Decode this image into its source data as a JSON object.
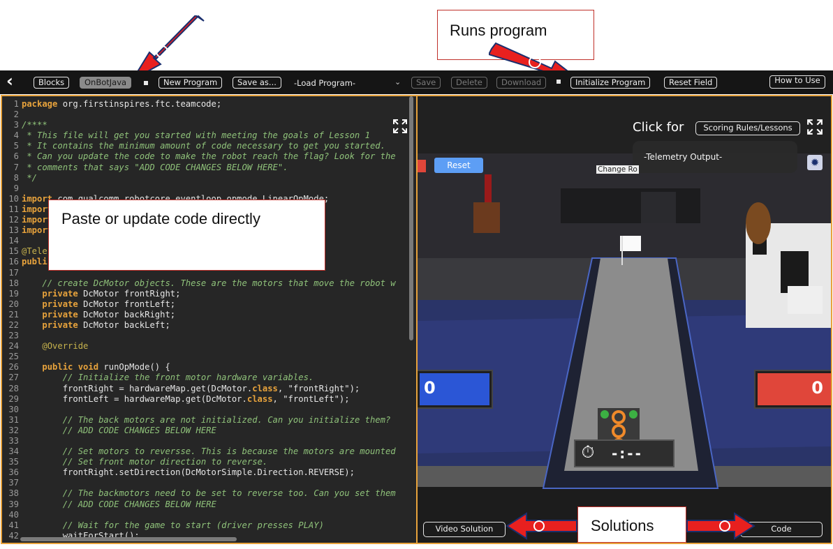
{
  "toolbar": {
    "back_glyph": "‹",
    "blocks": "Blocks",
    "onbotjava": "OnBotJava",
    "new_program": "New Program",
    "save_as": "Save as...",
    "load_program": "-Load Program-",
    "save": "Save",
    "delete": "Delete",
    "download": "Download",
    "initialize": "Initialize Program",
    "reset_field": "Reset Field",
    "how_to_use": "How to Use"
  },
  "callouts": {
    "runs_program": "Runs program",
    "paste_update": "Paste or update code directly",
    "solutions": "Solutions"
  },
  "sim": {
    "click_for": "Click for",
    "scoring_rules": "Scoring Rules/Lessons",
    "telemetry": "-Telemetry Output-",
    "reset": "Reset",
    "change_robot": "Change Ro",
    "score_blue": "0",
    "score_red": "0",
    "timer": "-:--",
    "video_solution": "Video Solution",
    "code": "Code"
  },
  "code_lines": [
    {
      "n": "1",
      "html": "<span class='kw'>package</span> org.firstinspires.ftc.teamcode;"
    },
    {
      "n": "2",
      "html": ""
    },
    {
      "n": "3",
      "html": "<span class='cm'>/****</span>"
    },
    {
      "n": "4",
      "html": "<span class='cm'> * This file will get you started with meeting the goals of Lesson 1</span>"
    },
    {
      "n": "5",
      "html": "<span class='cm'> * It contains the minimum amount of code necessary to get you started.</span>"
    },
    {
      "n": "6",
      "html": "<span class='cm'> * Can you update the code to make the robot reach the flag? Look for the</span>"
    },
    {
      "n": "7",
      "html": "<span class='cm'> * comments that says \"ADD CODE CHANGES BELOW HERE\".</span>"
    },
    {
      "n": "8",
      "html": "<span class='cm'> */</span>"
    },
    {
      "n": "9",
      "html": ""
    },
    {
      "n": "10",
      "html": "<span class='kw'>import</span> com.qualcomm.robotcore.eventloop.opmode.LinearOpMode;"
    },
    {
      "n": "11",
      "html": "<span class='kw'>import</span>"
    },
    {
      "n": "12",
      "html": "<span class='kw'>import</span>"
    },
    {
      "n": "13",
      "html": "<span class='kw'>import</span>"
    },
    {
      "n": "14",
      "html": ""
    },
    {
      "n": "15",
      "html": "<span class='an'>@Tele</span>                                            )"
    },
    {
      "n": "16",
      "html": "<span class='kw'>publi</span>"
    },
    {
      "n": "17",
      "html": ""
    },
    {
      "n": "18",
      "html": "    <span class='cm'>// create DcMotor objects. These are the motors that move the robot w</span>"
    },
    {
      "n": "19",
      "html": "    <span class='kw'>private</span> DcMotor frontRight;"
    },
    {
      "n": "20",
      "html": "    <span class='kw'>private</span> DcMotor frontLeft;"
    },
    {
      "n": "21",
      "html": "    <span class='kw'>private</span> DcMotor backRight;"
    },
    {
      "n": "22",
      "html": "    <span class='kw'>private</span> DcMotor backLeft;"
    },
    {
      "n": "23",
      "html": ""
    },
    {
      "n": "24",
      "html": "    <span class='an'>@Override</span>"
    },
    {
      "n": "25",
      "html": ""
    },
    {
      "n": "26",
      "html": "    <span class='kw'>public void</span> runOpMode() {"
    },
    {
      "n": "27",
      "html": "        <span class='cm'>// Initialize the front motor hardware variables.</span>"
    },
    {
      "n": "28",
      "html": "        frontRight = hardwareMap.get(DcMotor.<span class='kw'>class</span>, \"frontRight\");"
    },
    {
      "n": "29",
      "html": "        frontLeft = hardwareMap.get(DcMotor.<span class='kw'>class</span>, \"frontLeft\");"
    },
    {
      "n": "30",
      "html": ""
    },
    {
      "n": "31",
      "html": "        <span class='cm'>// The back motors are not initialized. Can you initialize them?</span>"
    },
    {
      "n": "32",
      "html": "        <span class='cm'>// ADD CODE CHANGES BELOW HERE</span>"
    },
    {
      "n": "33",
      "html": ""
    },
    {
      "n": "34",
      "html": "        <span class='cm'>// Set motors to reversse. This is because the motors are mounted</span>"
    },
    {
      "n": "35",
      "html": "        <span class='cm'>// Set front motor direction to reverse.</span>"
    },
    {
      "n": "36",
      "html": "        frontRight.setDirection(DcMotorSimple.Direction.REVERSE);"
    },
    {
      "n": "37",
      "html": ""
    },
    {
      "n": "38",
      "html": "        <span class='cm'>// The backmotors need to be set to reverse too. Can you set them</span>"
    },
    {
      "n": "39",
      "html": "        <span class='cm'>// ADD CODE CHANGES BELOW HERE</span>"
    },
    {
      "n": "40",
      "html": ""
    },
    {
      "n": "41",
      "html": "        <span class='cm'>// Wait for the game to start (driver presses PLAY)</span>"
    },
    {
      "n": "42",
      "html": "        waitForStart();"
    }
  ],
  "colors": {
    "accent": "#e8a33c",
    "callout_border": "#c0302a",
    "arrow": "#e8201f",
    "blue_score": "#2b56d6",
    "red_score": "#e0463a"
  }
}
